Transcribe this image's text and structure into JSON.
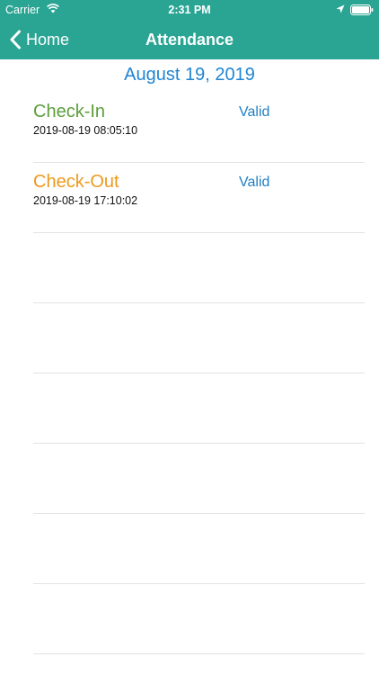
{
  "status_bar": {
    "carrier": "Carrier",
    "time": "2:31 PM"
  },
  "nav": {
    "back_label": "Home",
    "title": "Attendance",
    "color": "#2aa594"
  },
  "date_header": "August 19, 2019",
  "records": [
    {
      "type": "Check-In",
      "timestamp": "2019-08-19 08:05:10",
      "status": "Valid",
      "color": "#5b9e3c"
    },
    {
      "type": "Check-Out",
      "timestamp": "2019-08-19 17:10:02",
      "status": "Valid",
      "color": "#ec9a1d"
    }
  ],
  "icons": [
    "wifi-icon",
    "location-arrow-icon",
    "battery-icon",
    "chevron-left-icon"
  ]
}
